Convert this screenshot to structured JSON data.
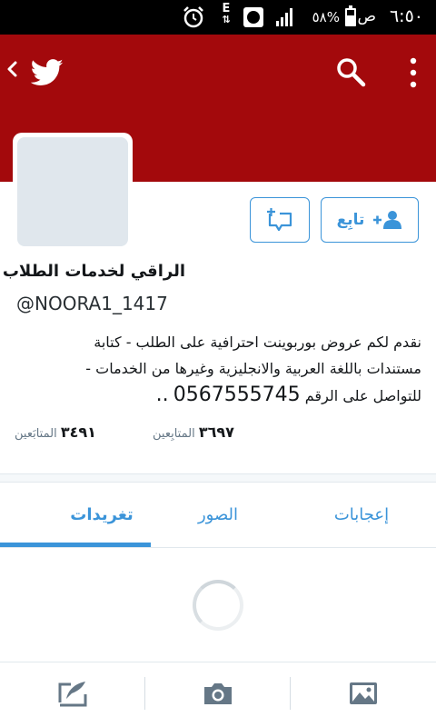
{
  "status_bar": {
    "time": "٦:٥٠",
    "ampm": "ص",
    "battery": "٥٨%",
    "network": "E"
  },
  "profile": {
    "name": "الراقي لخدمات الطلاب",
    "handle": "@NOORA1_1417",
    "bio_line1": "نقدم لكم عروض بوربوينت احترافية على الطلب - كتابة",
    "bio_line2": "مستندات باللغة العربية والانجليزية وغيرها من الخدمات -",
    "bio_line3_text": "للتواصل على الرقم",
    "bio_phone": "0567555745",
    "bio_tail": "..",
    "follow_label": "تابِع"
  },
  "stats": {
    "following_count": "٣٤٩١",
    "following_label": "المتابَعين",
    "followers_count": "٣٦٩٧",
    "followers_label": "المتابِعين"
  },
  "tabs": {
    "tweets": "تغريدات",
    "photos": "الصور",
    "likes": "إعجابات"
  },
  "colors": {
    "header": "#a3090c",
    "accent": "#3b94d9"
  },
  "icons": {
    "header": [
      "back-icon",
      "twitter-bird-icon",
      "search-icon",
      "more-vertical-icon"
    ],
    "bottom": [
      "compose-icon",
      "camera-icon",
      "gallery-icon"
    ]
  }
}
